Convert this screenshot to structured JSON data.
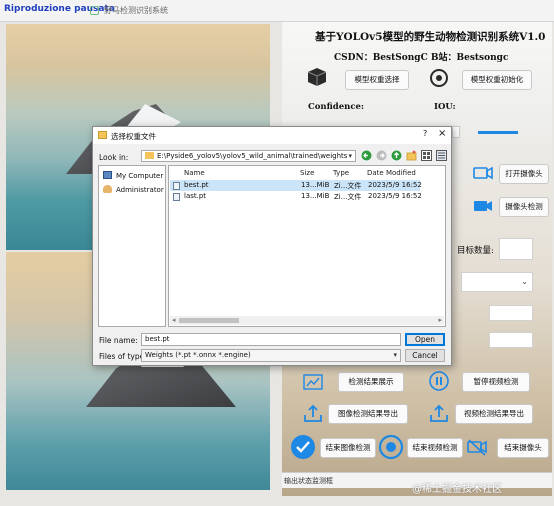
{
  "window": {
    "title": "野马检测识别系统",
    "badge": "Riproduzione pausata",
    "system_title": "基于YOLOv5模型的野生动物检测识别系统V1.0",
    "credits": "CSDN：BestSongC   B站：Bestsongc",
    "buttons": {
      "model_select": "模型权重选择",
      "model_init": "模型权重初始化",
      "open_camera": "打开摄像头",
      "camera_detect": "摄像头检测",
      "result_show": "检测结果展示",
      "pause_video": "暂停视频检测",
      "export_image": "图像检测结果导出",
      "export_video": "视频检测结果导出",
      "end_image": "结束图像检测",
      "end_video": "结束视频检测",
      "end_camera": "结束摄像头"
    },
    "labels": {
      "confidence": "Confidence:",
      "iou": "IOU:",
      "target_count": "目标数量:"
    },
    "status_bar": "输出状态监测框",
    "watermark": "@稀土掘金技术社区",
    "colors": {
      "accent": "#1e88e5"
    }
  },
  "dialog": {
    "title": "选择权重文件",
    "help": "?",
    "close": "×",
    "look_in_label": "Look in:",
    "look_in_path": "E:\\Pyside6_yolov5\\yolov5_wild_animal\\trained\\weights",
    "sidebar": [
      {
        "label": "My Computer",
        "icon": "computer-icon"
      },
      {
        "label": "Administrator",
        "icon": "user-icon"
      }
    ],
    "columns": [
      "Name",
      "Size",
      "Type",
      "Date Modified"
    ],
    "files": [
      {
        "name": "best.pt",
        "size": "13...MiB",
        "type": "Zi...文件",
        "date": "2023/5/9 16:52",
        "selected": true
      },
      {
        "name": "last.pt",
        "size": "13...MiB",
        "type": "Zi...文件",
        "date": "2023/5/9 16:52",
        "selected": false
      }
    ],
    "file_name_label": "File name:",
    "file_name_value": "best.pt",
    "file_type_label": "Files of type:",
    "file_type_value": "Weights (*.pt *.onnx *.engine)",
    "open_label": "Open",
    "cancel_label": "Cancel"
  }
}
